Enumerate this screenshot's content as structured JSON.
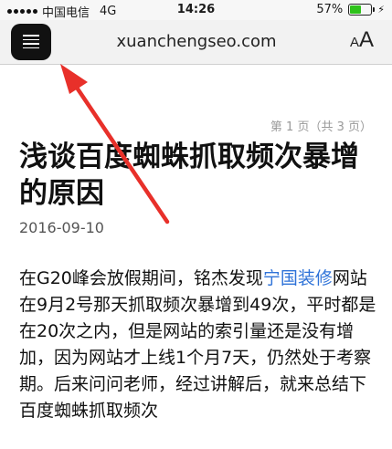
{
  "status_bar": {
    "carrier": "中国电信",
    "network": "4G",
    "time": "14:26",
    "battery_percent": "57%",
    "battery_level": 0.57,
    "battery_color": "#2ec21a"
  },
  "address_bar": {
    "menu_icon": "menu-icon",
    "domain": "xuanchengseo.com",
    "font_small": "A",
    "font_large": "A"
  },
  "article": {
    "pager": "第 1 页（共 3 页）",
    "title": "浅谈百度蜘蛛抓取频次暴增的原因",
    "date": "2016-09-10",
    "para_before_link": "在G20峰会放假期间，铭杰发现",
    "link_text": "宁国装修",
    "para_after_link": "网站在9月2号那天抓取频次暴增到49次，平时都是在20次之内，但是网站的索引量还是没有增加，因为网站才上线1个月7天，仍然处于考察期。后来问问老师，经过讲解后，就来总结下百度蜘蛛抓取频次",
    "link_color": "#2f73d8"
  },
  "annotation": {
    "arrow_color": "#e8302a"
  }
}
